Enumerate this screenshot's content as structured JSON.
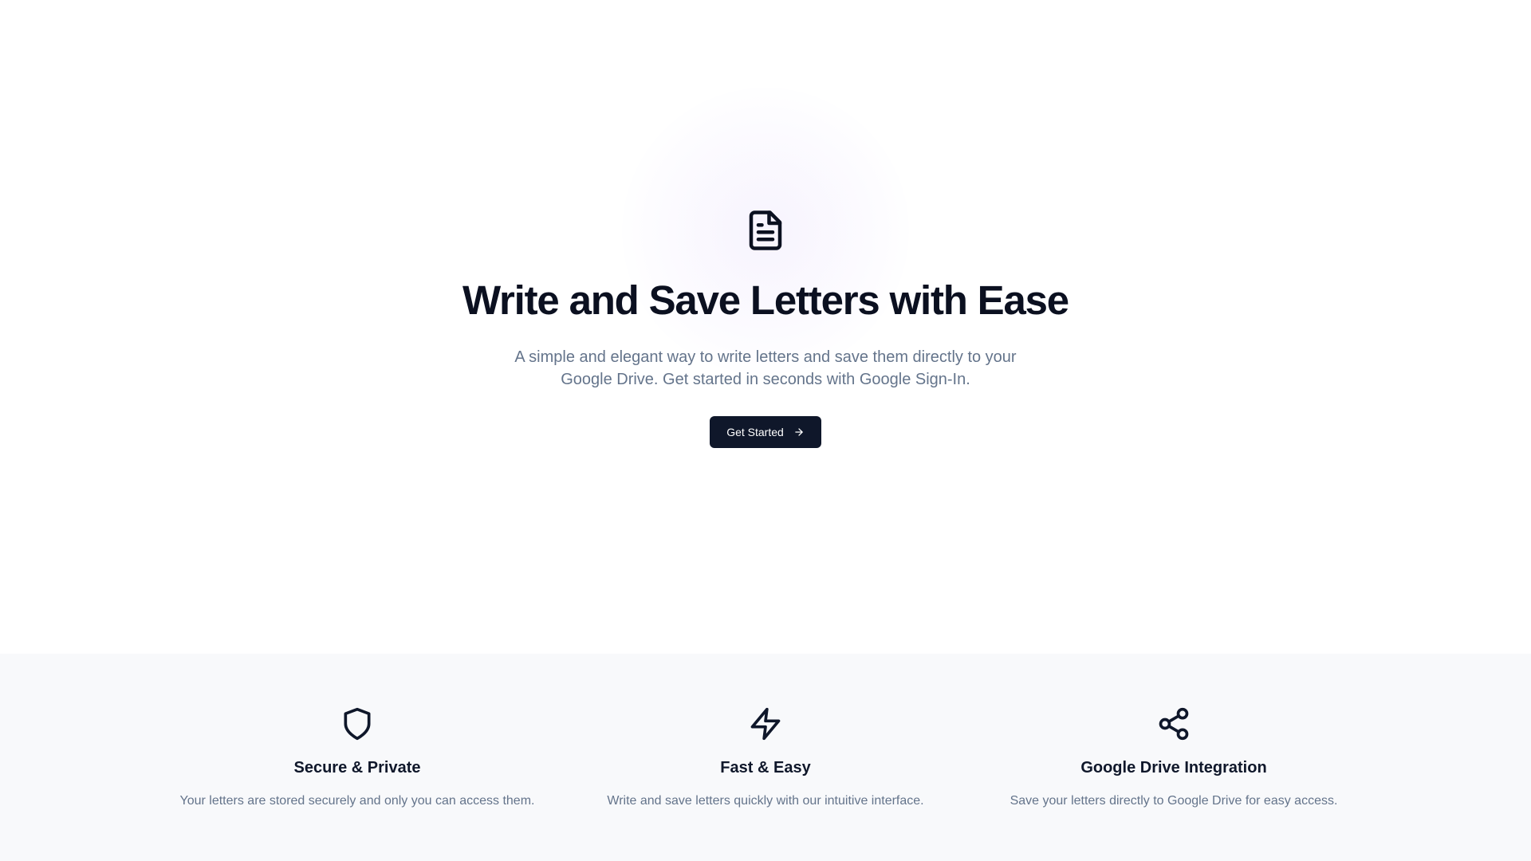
{
  "hero": {
    "icon": "file-text-icon",
    "title": "Write and Save Letters with Ease",
    "subtitle": "A simple and elegant way to write letters and save them directly to your Google Drive. Get started in seconds with Google Sign-In.",
    "cta_label": "Get Started",
    "cta_icon": "arrow-right-icon"
  },
  "features": [
    {
      "icon": "shield-icon",
      "title": "Secure & Private",
      "description": "Your letters are stored securely and only you can access them."
    },
    {
      "icon": "zap-icon",
      "title": "Fast & Easy",
      "description": "Write and save letters quickly with our intuitive interface."
    },
    {
      "icon": "share-icon",
      "title": "Google Drive Integration",
      "description": "Save your letters directly to Google Drive for easy access."
    }
  ],
  "colors": {
    "primary": "#0f172a",
    "muted_text": "#64748b",
    "feature_bg": "#f8f9fb",
    "glow": "#8b5cf6"
  }
}
